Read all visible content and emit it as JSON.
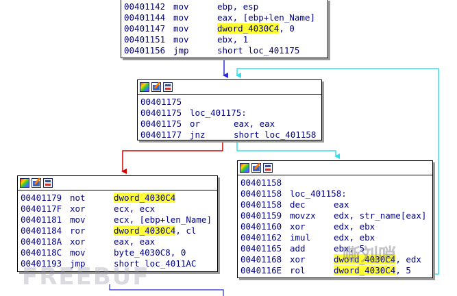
{
  "colors": {
    "branch_true": "#d40000",
    "branch_false": "#33ddee",
    "jump": "#2a2ad8",
    "back_edge": "#33ddee",
    "highlight": "#ffff33"
  },
  "watermark": {
    "text": "FREEBUF",
    "cn_text": "嘶刘哨"
  },
  "blocks": [
    {
      "id": "block-401142",
      "toolbar": false,
      "lines": [
        {
          "addr": "00401142",
          "mn": "mov",
          "op": "ebp, esp",
          "hl": ""
        },
        {
          "addr": "00401144",
          "mn": "mov",
          "op": "eax, [ebp+len_Name]",
          "hl": ""
        },
        {
          "addr": "00401147",
          "mn": "mov",
          "op": ", 0",
          "hl": "dword_4030C4"
        },
        {
          "addr": "00401151",
          "mn": "mov",
          "op": "ebx, 1",
          "hl": ""
        },
        {
          "addr": "00401156",
          "mn": "jmp",
          "op": "short loc_401175",
          "hl": ""
        }
      ]
    },
    {
      "id": "block-401175",
      "toolbar": true,
      "lines": [
        {
          "addr": "00401175",
          "mn": "",
          "op": "",
          "hl": ""
        },
        {
          "addr": "00401175",
          "mn": "loc_401175:",
          "op": "",
          "hl": ""
        },
        {
          "addr": "00401175",
          "mn": "or",
          "op": "eax, eax",
          "hl": ""
        },
        {
          "addr": "00401177",
          "mn": "jnz",
          "op": "short loc_401158",
          "hl": ""
        }
      ]
    },
    {
      "id": "block-401179",
      "toolbar": true,
      "lines": [
        {
          "addr": "00401179",
          "mn": "not",
          "op": "",
          "hl": "dword_4030C4"
        },
        {
          "addr": "0040117F",
          "mn": "xor",
          "op": "ecx, ecx",
          "hl": ""
        },
        {
          "addr": "00401181",
          "mn": "mov",
          "op": "ecx, [ebp+len_Name]",
          "hl": ""
        },
        {
          "addr": "00401184",
          "mn": "ror",
          "op": ", cl",
          "hl": "dword_4030C4"
        },
        {
          "addr": "0040118A",
          "mn": "xor",
          "op": "eax, eax",
          "hl": ""
        },
        {
          "addr": "0040118C",
          "mn": "mov",
          "op": "byte_4030C8, 0",
          "hl": ""
        },
        {
          "addr": "00401193",
          "mn": "jmp",
          "op": "short loc_4011AC",
          "hl": ""
        }
      ]
    },
    {
      "id": "block-401158",
      "toolbar": true,
      "lines": [
        {
          "addr": "00401158",
          "mn": "",
          "op": "",
          "hl": ""
        },
        {
          "addr": "00401158",
          "mn": "loc_401158:",
          "op": "",
          "hl": ""
        },
        {
          "addr": "00401158",
          "mn": "dec",
          "op": "eax",
          "hl": ""
        },
        {
          "addr": "00401159",
          "mn": "movzx",
          "op": "edx, str_name[eax]",
          "hl": ""
        },
        {
          "addr": "00401160",
          "mn": "xor",
          "op": "edx, ebx",
          "hl": ""
        },
        {
          "addr": "00401162",
          "mn": "imul",
          "op": "edx, ebx",
          "hl": ""
        },
        {
          "addr": "00401165",
          "mn": "add",
          "op": "ebx, 5",
          "hl": ""
        },
        {
          "addr": "00401168",
          "mn": "xor",
          "op": ", edx",
          "hl": "dword_4030C4"
        },
        {
          "addr": "0040116E",
          "mn": "rol",
          "op": ", 5",
          "hl": "dword_4030C4"
        }
      ]
    }
  ]
}
